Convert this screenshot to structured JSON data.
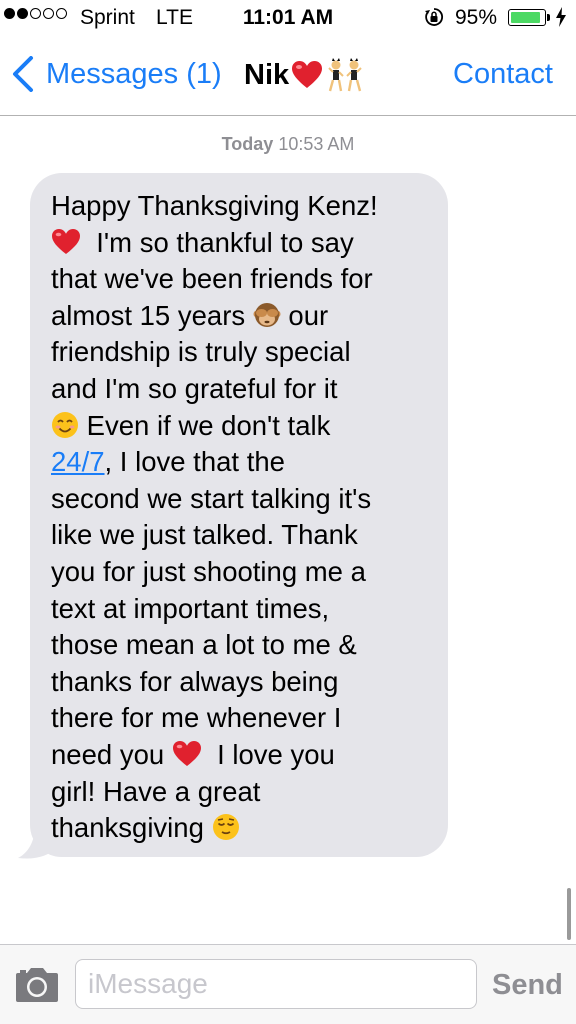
{
  "status_bar": {
    "carrier": "Sprint",
    "network": "LTE",
    "time": "11:01 AM",
    "battery_percent": "95%",
    "battery_level": 0.95,
    "signal_bars_filled": 2,
    "signal_bars_total": 5
  },
  "nav": {
    "back_label": "Messages (1)",
    "title": "Nik",
    "contact_label": "Contact"
  },
  "timestamp": {
    "day": "Today",
    "time": "10:53 AM"
  },
  "message": {
    "lines": [
      {
        "parts": [
          {
            "t": "Happy Thanksgiving Kenz!"
          }
        ]
      },
      {
        "parts": [
          {
            "emoji": "red-heart"
          },
          {
            "t": "  I'm so thankful to say"
          }
        ]
      },
      {
        "parts": [
          {
            "t": "that we've been friends for"
          }
        ]
      },
      {
        "parts": [
          {
            "t": "almost 15 years "
          },
          {
            "emoji": "see-no-evil-monkey"
          },
          {
            "t": " our"
          }
        ]
      },
      {
        "parts": [
          {
            "t": "friendship is truly special"
          }
        ]
      },
      {
        "parts": [
          {
            "t": "and I'm so grateful for it"
          }
        ]
      },
      {
        "parts": [
          {
            "emoji": "smiling-face"
          },
          {
            "t": " Even if we don't talk"
          }
        ]
      },
      {
        "parts": [
          {
            "link": "24/7"
          },
          {
            "t": ", I love that the"
          }
        ]
      },
      {
        "parts": [
          {
            "t": "second we start talking it's"
          }
        ]
      },
      {
        "parts": [
          {
            "t": "like we just talked. Thank"
          }
        ]
      },
      {
        "parts": [
          {
            "t": "you for just shooting me a"
          }
        ]
      },
      {
        "parts": [
          {
            "t": "text at important times,"
          }
        ]
      },
      {
        "parts": [
          {
            "t": "those mean a lot to me &"
          }
        ]
      },
      {
        "parts": [
          {
            "t": "thanks for always being"
          }
        ]
      },
      {
        "parts": [
          {
            "t": "there for me whenever I"
          }
        ]
      },
      {
        "parts": [
          {
            "t": "need you "
          },
          {
            "emoji": "red-heart"
          },
          {
            "t": "  I love you"
          }
        ]
      },
      {
        "parts": [
          {
            "t": "girl! Have a great"
          }
        ]
      },
      {
        "parts": [
          {
            "t": "thanksgiving "
          },
          {
            "emoji": "relieved-face"
          }
        ]
      }
    ]
  },
  "input": {
    "placeholder": "iMessage",
    "value": "",
    "send_label": "Send"
  },
  "colors": {
    "accent": "#1a7df7",
    "bubble": "#e5e5ea",
    "battery": "#4cd964",
    "muted": "#8e8e93"
  }
}
